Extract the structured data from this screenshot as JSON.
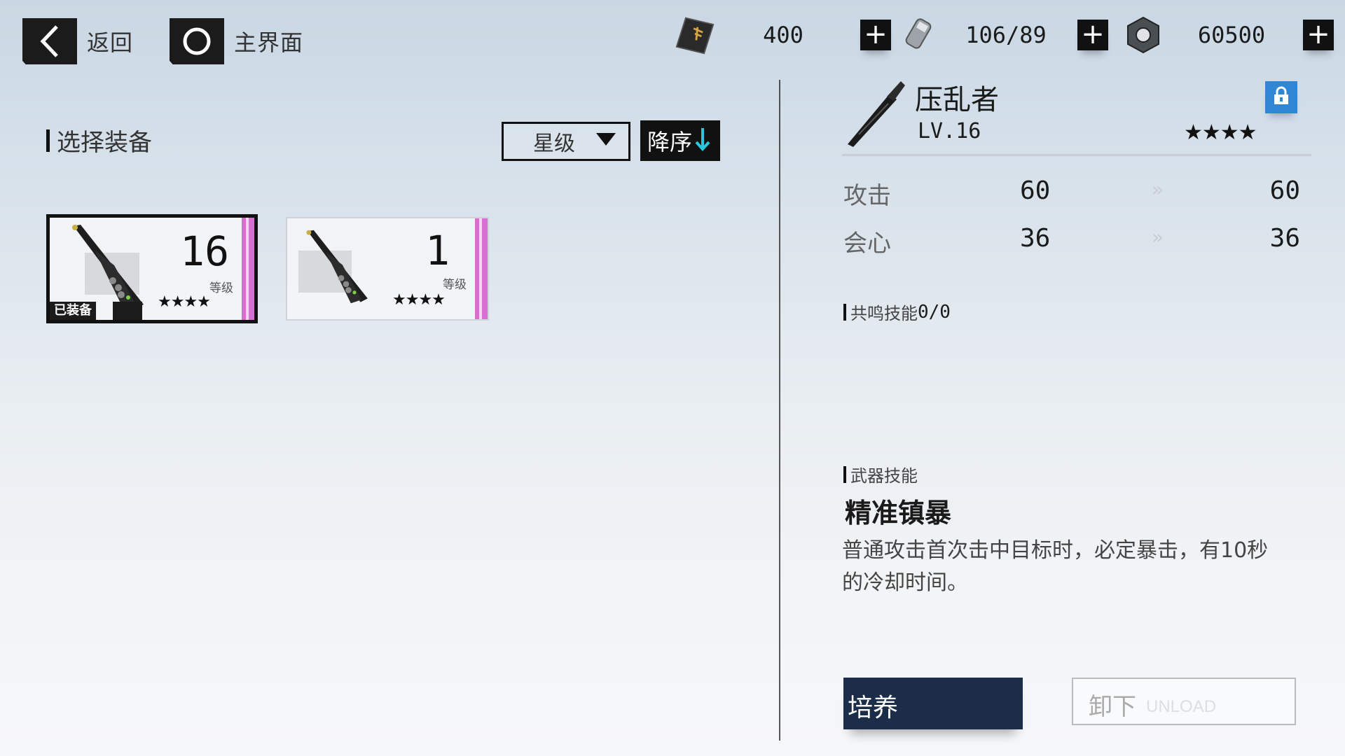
{
  "nav": {
    "back_label": "返回",
    "home_label": "主界面"
  },
  "currencies": [
    {
      "icon": "weapon-ticket-icon",
      "value": "400"
    },
    {
      "icon": "battery-icon",
      "value": "106/89"
    },
    {
      "icon": "hex-nut-icon",
      "value": "60500"
    }
  ],
  "left": {
    "section_title": "选择装备",
    "sort_select": "星级",
    "sort_order": "降序",
    "cards": [
      {
        "level": "16",
        "level_label": "等级",
        "stars": "★★★★",
        "equipped_label": "已装备"
      },
      {
        "level": "1",
        "level_label": "等级",
        "stars": "★★★★"
      }
    ]
  },
  "right": {
    "weapon_name": "压乱者",
    "weapon_level": "LV.16",
    "weapon_stars": "★★★★",
    "stats": [
      {
        "label": "攻击",
        "current": "60",
        "next": "60"
      },
      {
        "label": "会心",
        "current": "36",
        "next": "36"
      }
    ],
    "resonance_label": "共鸣技能",
    "resonance_value": "0/0",
    "weapon_skill_label": "武器技能",
    "skill_name": "精准镇暴",
    "skill_desc_line1": "普通攻击首次击中目标时，必定暴击，有10秒",
    "skill_desc_line2": "的冷却时间。",
    "train_label": "培养",
    "unload_label": "卸下",
    "unload_sub": "UNLOAD"
  },
  "colors": {
    "accent_dark": "#1b2d48",
    "rarity": "#d86fd0",
    "lock_blue": "#2f86d4",
    "sort_arrow": "#29c6e0"
  }
}
